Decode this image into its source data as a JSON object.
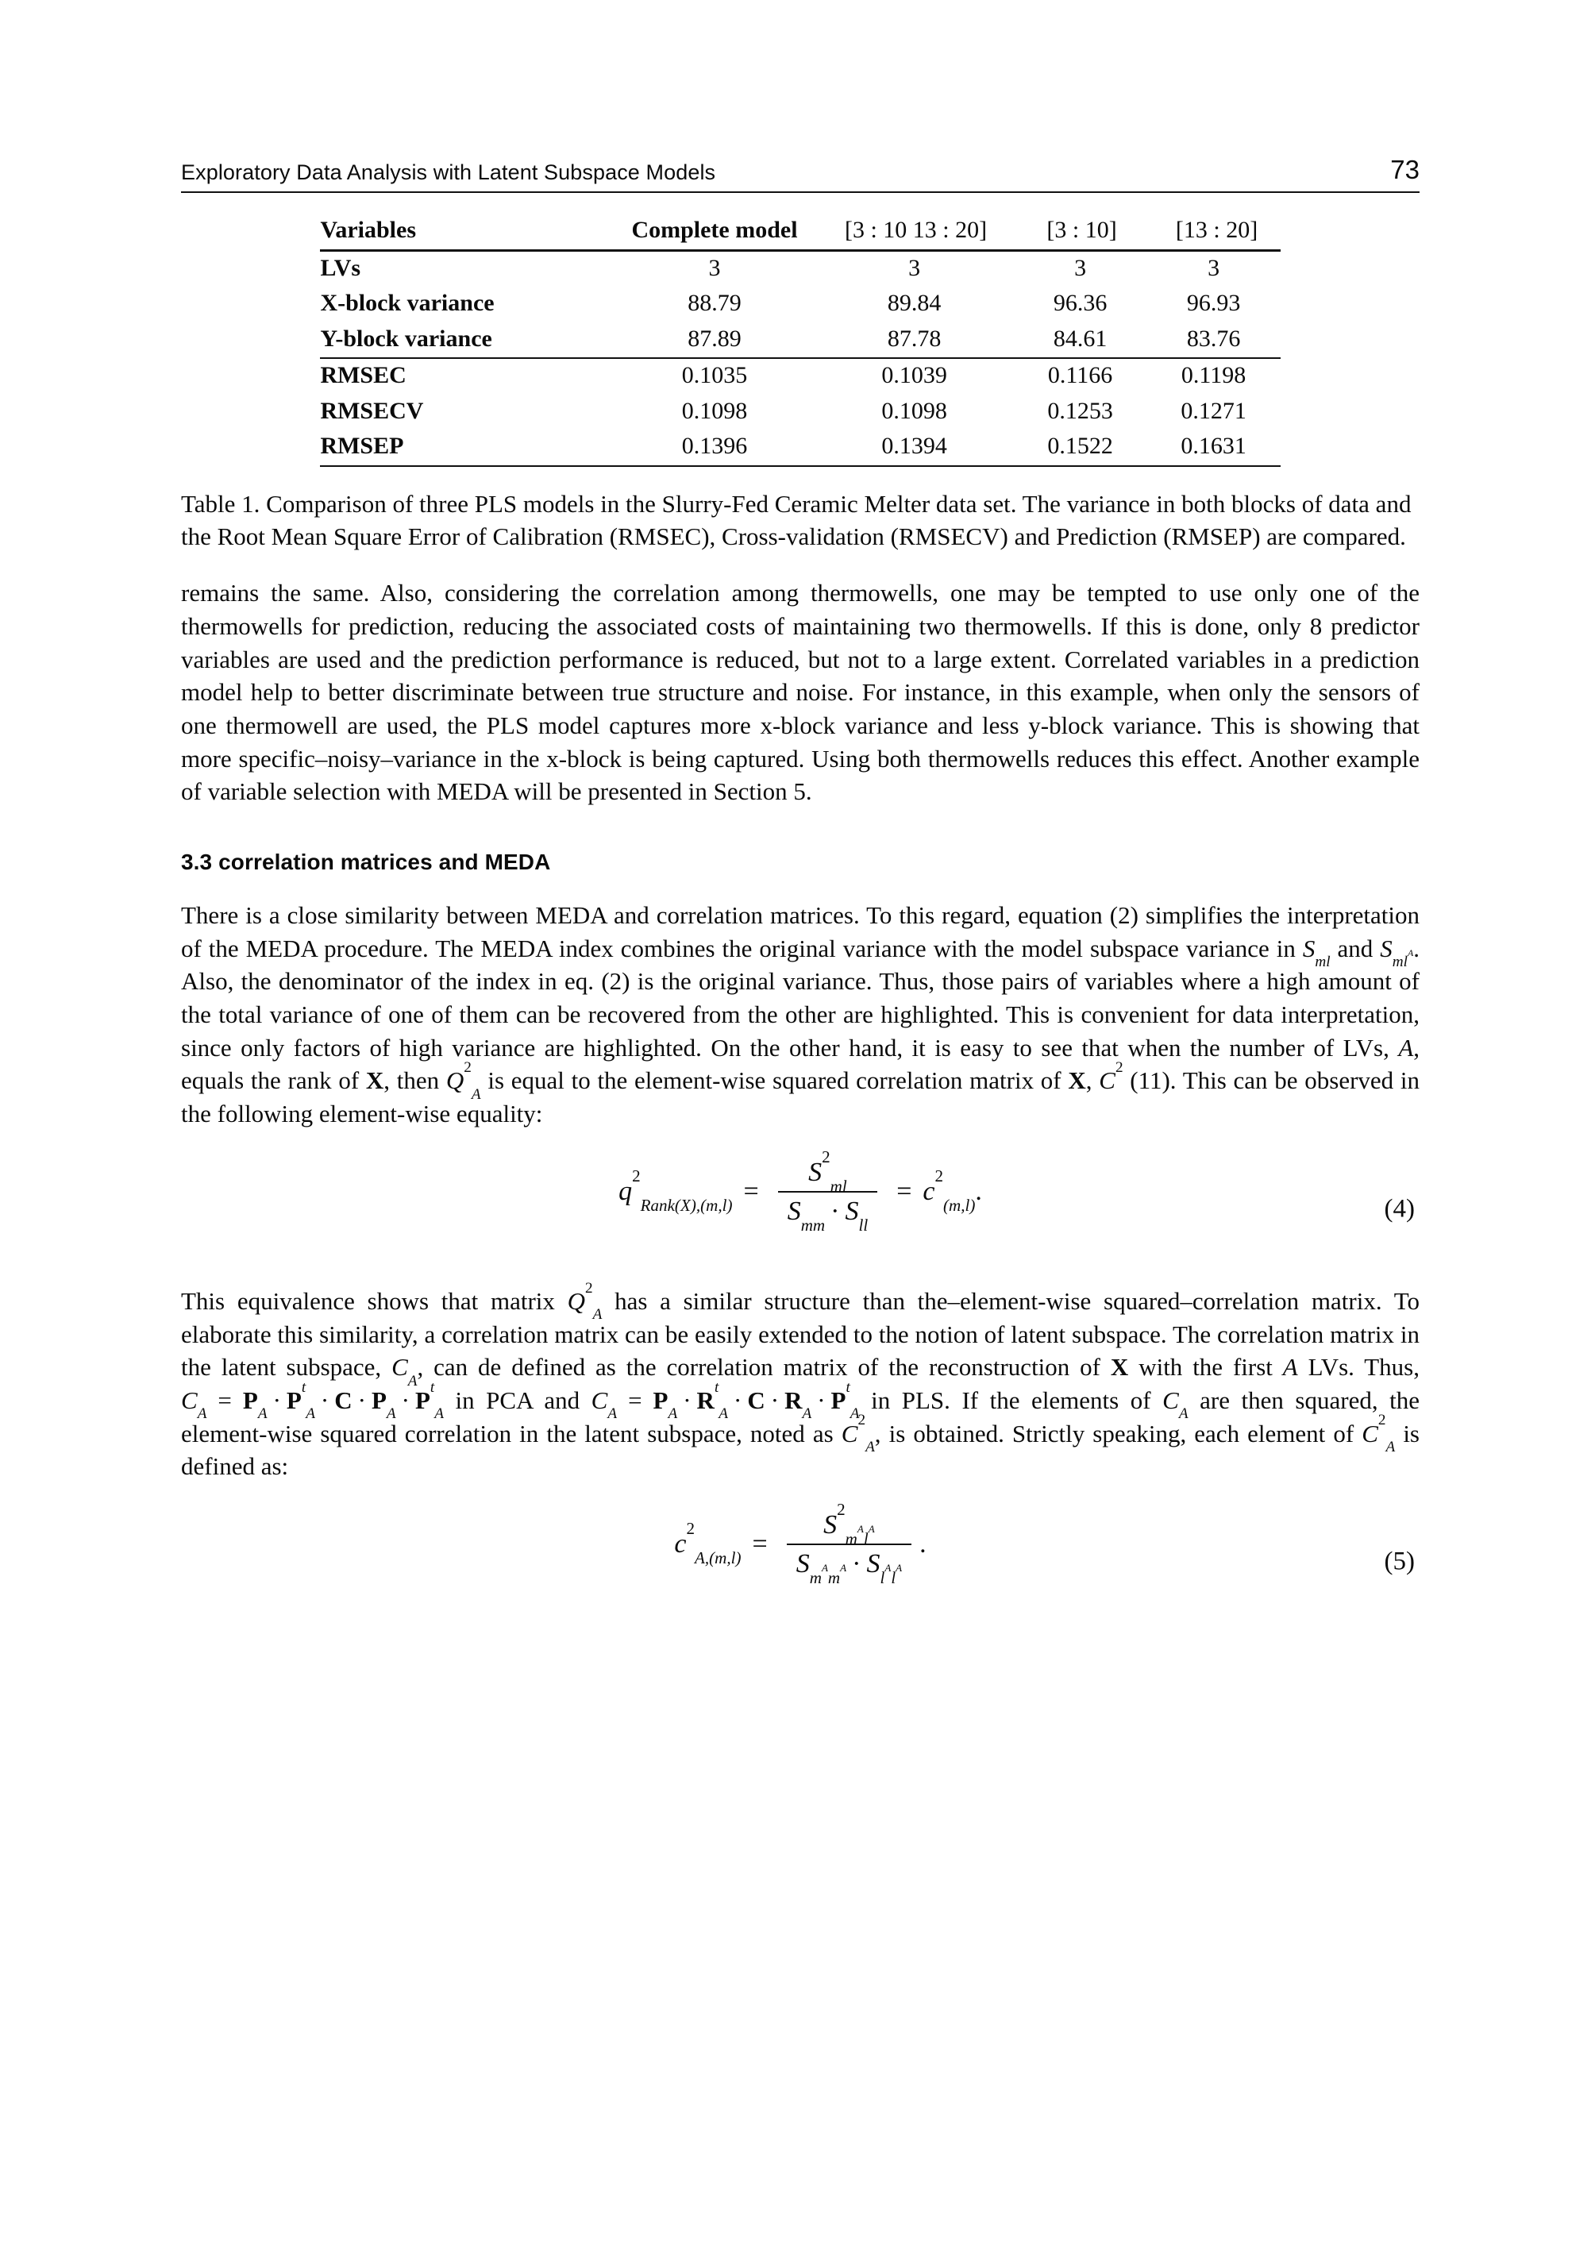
{
  "header": {
    "title": "Exploratory Data Analysis with Latent Subspace Models",
    "page_number": "73"
  },
  "table": {
    "columns": [
      "Variables",
      "Complete model",
      "[3 : 10 13 : 20]",
      "[3 : 10]",
      "[13 : 20]"
    ],
    "rows": [
      {
        "label": "LVs",
        "values": [
          "3",
          "3",
          "3",
          "3"
        ]
      },
      {
        "label": "X-block variance",
        "values": [
          "88.79",
          "89.84",
          "96.36",
          "96.93"
        ]
      },
      {
        "label": "Y-block variance",
        "values": [
          "87.89",
          "87.78",
          "84.61",
          "83.76"
        ]
      },
      {
        "label": "RMSEC",
        "values": [
          "0.1035",
          "0.1039",
          "0.1166",
          "0.1198"
        ]
      },
      {
        "label": "RMSECV",
        "values": [
          "0.1098",
          "0.1098",
          "0.1253",
          "0.1271"
        ]
      },
      {
        "label": "RMSEP",
        "values": [
          "0.1396",
          "0.1394",
          "0.1522",
          "0.1631"
        ]
      }
    ],
    "caption": "Table 1. Comparison of three PLS models in the Slurry-Fed Ceramic Melter data set. The variance in both blocks of data and the Root Mean Square Error of Calibration (RMSEC), Cross-validation (RMSECV) and Prediction (RMSEP) are compared."
  },
  "body": {
    "paragraph_1": "remains the same. Also, considering the correlation among thermowells, one may be tempted to use only one of the thermowells for prediction, reducing the associated costs of maintaining two thermowells. If this is done, only 8 predictor variables are used and the prediction performance is reduced, but not to a large extent. Correlated variables in a prediction model help to better discriminate between true structure and noise. For instance, in this example, when only the sensors of one thermowell are used, the PLS model captures more x-block variance and less y-block variance. This is showing that more specific–noisy–variance in the x-block is being captured. Using both thermowells reduces this effect. Another example of variable selection with MEDA will be presented in Section 5.",
    "section_heading": "3.3 correlation matrices and MEDA",
    "paragraph_2_part1": "There is a close similarity between MEDA and correlation matrices. To this regard, equation (2) simplifies the interpretation of the MEDA procedure. The MEDA index combines the original variance with the model subspace variance in ",
    "paragraph_2_sml": "S",
    "paragraph_2_sml_sub": "ml",
    "paragraph_2_part2": " and ",
    "paragraph_2_smla_sub": "ml",
    "paragraph_2_smla_sup": "A",
    "paragraph_2_part3": ". Also, the denominator of the index in eq. (2) is the original variance. Thus, those pairs of variables where a high amount of the total variance of one of them can be recovered from the other are highlighted. This is convenient for data interpretation, since only factors of high variance are highlighted. On the other hand, it is easy to see that when the number of LVs, ",
    "paragraph_2_A": "A",
    "paragraph_2_part4": ", equals the rank of ",
    "paragraph_2_X": "X",
    "paragraph_2_part5": ", then ",
    "paragraph_2_Q": "Q",
    "paragraph_2_Q_sub": "A",
    "paragraph_2_Q_sup": "2",
    "paragraph_2_part6": " is equal to the element-wise squared correlation matrix of ",
    "paragraph_2_X2": "X",
    "paragraph_2_part7": ", ",
    "paragraph_2_C": "C",
    "paragraph_2_C_sup": "2",
    "paragraph_2_part8": " (11). This can be observed in the following element-wise equality:",
    "paragraph_3_part1": "This equivalence shows that matrix ",
    "paragraph_3_Q": "Q",
    "paragraph_3_Q_sub": "A",
    "paragraph_3_Q_sup": "2",
    "paragraph_3_part2": " has a similar structure than the–element-wise squared–correlation matrix. To elaborate this similarity, a correlation matrix can be easily extended to the notion of latent subspace. The correlation matrix in the latent subspace, ",
    "paragraph_3_CA": "C",
    "paragraph_3_CA_sub": "A",
    "paragraph_3_part3": ", can de defined as the correlation matrix of the reconstruction of ",
    "paragraph_3_X": "X",
    "paragraph_3_part4": " with the first ",
    "paragraph_3_A": "A",
    "paragraph_3_part5": " LVs. Thus, ",
    "paragraph_3_part6": " in PCA and ",
    "paragraph_3_part7": " in PLS. If the elements of ",
    "paragraph_3_part8": " are then squared, the element-wise squared correlation in the latent subspace, noted as ",
    "paragraph_3_part9": ", is obtained. Strictly speaking, each element of ",
    "paragraph_3_part10": " is defined as:"
  },
  "equations": {
    "eq4": {
      "number": "(4)",
      "lhs_symbol": "q",
      "lhs_sup": "2",
      "lhs_sub": "Rank(X),(m,l)",
      "equals": "=",
      "numerator_symbol": "S",
      "numerator_sup": "2",
      "numerator_sub": "ml",
      "denominator": "S",
      "denominator_sub_1": "mm",
      "denominator_dot": "·",
      "denominator_sub_2": "ll",
      "rhs_symbol": "c",
      "rhs_sup": "2",
      "rhs_sub": "(m,l)",
      "trailing": "."
    },
    "eq5": {
      "number": "(5)",
      "lhs_symbol": "c",
      "lhs_sup": "2",
      "lhs_sub": "A,(m,l)",
      "equals": "=",
      "numerator_symbol": "S",
      "numerator_sup": "2",
      "numerator_sub_m": "m",
      "numerator_sub_m_sup": "A",
      "numerator_sub_l": "l",
      "numerator_sub_l_sup": "A",
      "denominator_symbol": "S",
      "denominator_dot": "·",
      "trailing": "."
    },
    "inline_pca": {
      "CA": "C",
      "CA_sub": "A",
      "eq": "=",
      "P1": "P",
      "P1_sub": "A",
      "dot1": "·",
      "Pt1": "P",
      "Pt1_sub": "A",
      "Pt1_sup": "t",
      "dot2": "·",
      "Cmat": "C",
      "dot3": "·",
      "P2": "P",
      "P2_sub": "A",
      "dot4": "·",
      "Pt2": "P",
      "Pt2_sub": "A",
      "Pt2_sup": "t"
    },
    "inline_pls": {
      "CA": "C",
      "CA_sub": "A",
      "eq": "=",
      "P1": "P",
      "P1_sub": "A",
      "dot1": "·",
      "Rt": "R",
      "Rt_sub": "A",
      "Rt_sup": "t",
      "dot2": "·",
      "Cmat": "C",
      "dot3": "·",
      "R2": "R",
      "R2_sub": "A",
      "dot4": "·",
      "Pt2": "P",
      "Pt2_sub": "A",
      "Pt2_sup": "t"
    },
    "inline_C2A": {
      "C": "C",
      "sub": "A",
      "sup": "2"
    }
  }
}
